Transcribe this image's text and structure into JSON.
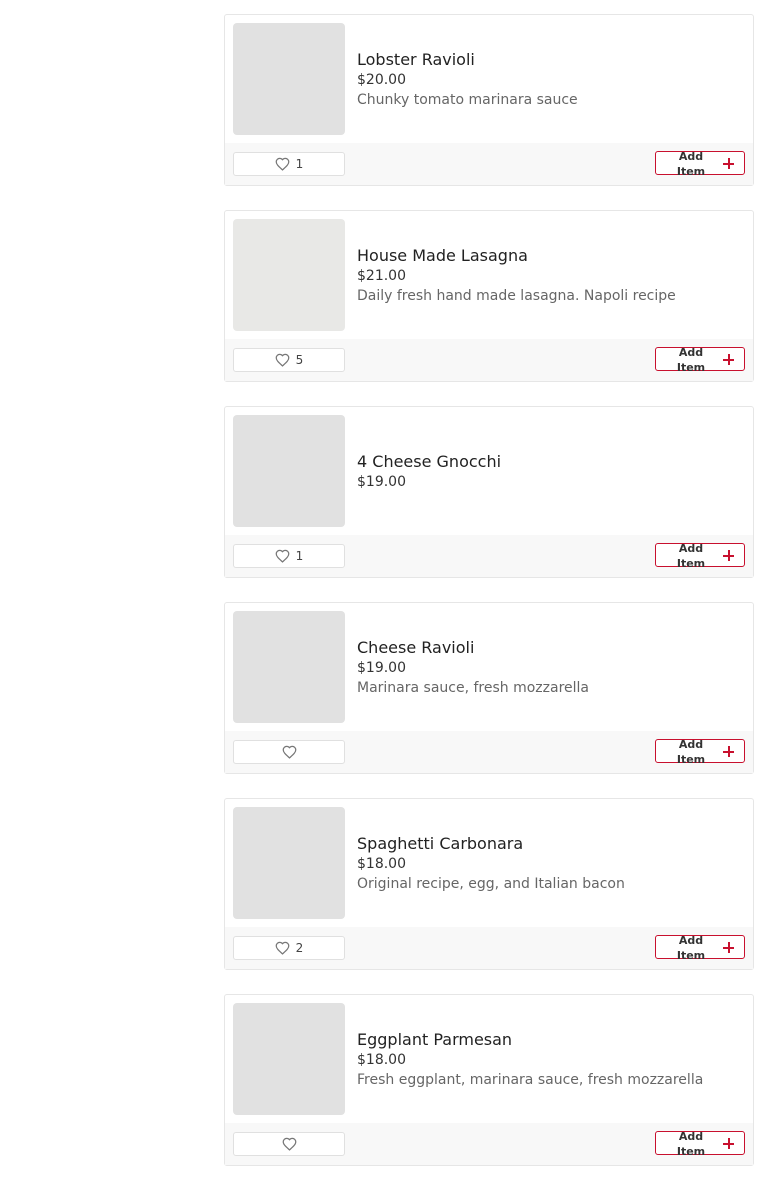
{
  "menu": {
    "add_label_line1": "Add",
    "add_label_line2": "Item",
    "items": [
      {
        "name": "Lobster Ravioli",
        "price": "$20.00",
        "description": "Chunky tomato marinara sauce",
        "likes": "1"
      },
      {
        "name": "House Made Lasagna",
        "price": "$21.00",
        "description": "Daily fresh hand made lasagna. Napoli recipe",
        "likes": "5"
      },
      {
        "name": "4 Cheese Gnocchi",
        "price": "$19.00",
        "description": "",
        "likes": "1"
      },
      {
        "name": "Cheese Ravioli",
        "price": "$19.00",
        "description": "Marinara sauce, fresh mozzarella",
        "likes": ""
      },
      {
        "name": "Spaghetti Carbonara",
        "price": "$18.00",
        "description": "Original recipe, egg, and Italian bacon",
        "likes": "2"
      },
      {
        "name": "Eggplant Parmesan",
        "price": "$18.00",
        "description": "Fresh eggplant, marinara sauce, fresh mozzarella",
        "likes": ""
      }
    ]
  },
  "colors": {
    "accent": "#c8102e",
    "thumb_placeholder": "#e1e1e1",
    "footer_bg": "#f8f8f8"
  },
  "icons": {
    "like": "heart-outline-icon",
    "add": "plus-icon"
  }
}
